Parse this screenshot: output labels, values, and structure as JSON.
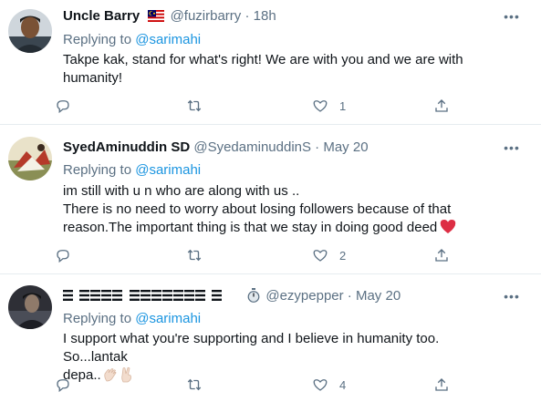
{
  "tweets": [
    {
      "name": "Uncle Barry",
      "handle": "@fuzirbarry",
      "separator": "·",
      "time": "18h",
      "replying_label": "Replying to",
      "replying_to": "@sarimahi",
      "text_lines": [
        "Takpe kak, stand for what's right! We are with you and we are with",
        "humanity!"
      ],
      "likes": "1",
      "icons": [
        "flag-malaysia-icon",
        "more-icon",
        "reply-icon",
        "retweet-icon",
        "like-icon",
        "share-icon"
      ]
    },
    {
      "name": "SyedAminuddin SD",
      "handle": "@SyedaminuddinS",
      "separator": "·",
      "time": "May 20",
      "replying_label": "Replying to",
      "replying_to": "@sarimahi",
      "text_lines": [
        "im still with u n who are along with us ..",
        "There is no need to worry about losing followers because of that",
        "reason.The important thing is that we stay in doing good deed"
      ],
      "likes": "2",
      "icons": [
        "red-heart-icon",
        "more-icon",
        "reply-icon",
        "retweet-icon",
        "like-icon",
        "share-icon"
      ]
    },
    {
      "name_glyph": "𝌆",
      "handle": "@ezypepper",
      "separator": "·",
      "time": "May 20",
      "replying_label": "Replying to",
      "replying_to": "@sarimahi",
      "text_lines": [
        "I support what you're supporting and I believe in humanity too. So...lantak",
        "depa.."
      ],
      "likes": "4",
      "icons": [
        "stopwatch-icon",
        "clapping-hands-icon",
        "victory-hand-icon",
        "more-icon",
        "reply-icon",
        "retweet-icon",
        "like-icon",
        "share-icon"
      ]
    }
  ],
  "colors": {
    "text": "#0f1419",
    "secondary": "#5b7083",
    "link": "#1b95e0",
    "divider": "#e6ecf0",
    "heart": "#e0245e"
  }
}
